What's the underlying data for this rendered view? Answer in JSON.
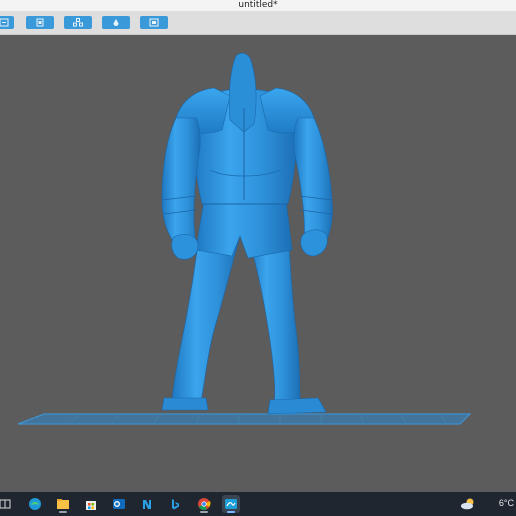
{
  "window": {
    "title": "untitled*"
  },
  "toolbar": {
    "buttons": [
      {
        "icon": "import-icon"
      },
      {
        "icon": "paste-icon"
      },
      {
        "icon": "arrange-icon"
      },
      {
        "icon": "support-icon"
      },
      {
        "icon": "fit-view-icon"
      }
    ]
  },
  "viewport": {
    "model_color": "#2f9ae6",
    "background": "#5c5c5c",
    "build_plate": "grid"
  },
  "taskbar": {
    "apps": [
      {
        "icon": "task-view-icon"
      },
      {
        "icon": "edge-icon"
      },
      {
        "icon": "file-explorer-icon"
      },
      {
        "icon": "store-icon"
      },
      {
        "icon": "outlook-icon"
      },
      {
        "icon": "app-n-icon"
      },
      {
        "icon": "bing-icon"
      },
      {
        "icon": "chrome-icon"
      },
      {
        "icon": "slicer-app-icon",
        "active": true
      }
    ],
    "weather": {
      "icon": "partly-cloudy-icon",
      "temperature": "6°C"
    }
  }
}
